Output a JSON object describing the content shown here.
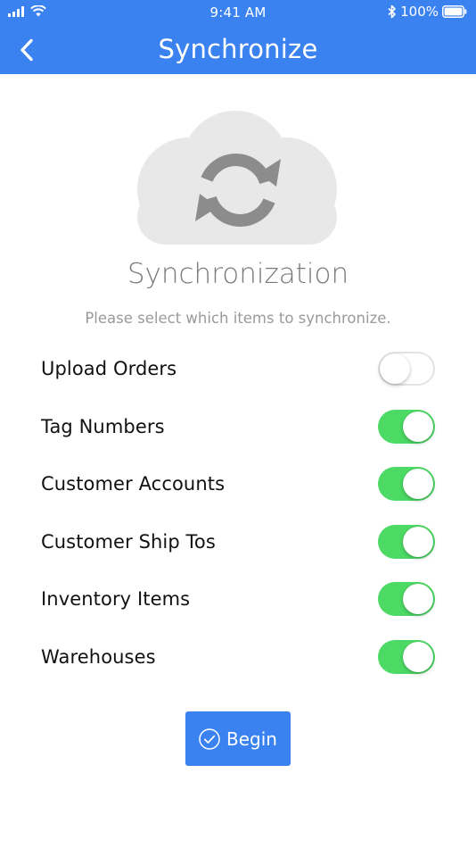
{
  "status_bar": {
    "time": "9:41 AM",
    "battery": "100%"
  },
  "nav": {
    "title": "Synchronize"
  },
  "hero": {
    "title": "Synchronization",
    "subtitle": "Please select which items to synchronize."
  },
  "options": [
    {
      "label": "Upload Orders",
      "enabled": false
    },
    {
      "label": "Tag Numbers",
      "enabled": true
    },
    {
      "label": "Customer Accounts",
      "enabled": true
    },
    {
      "label": "Customer Ship Tos",
      "enabled": true
    },
    {
      "label": "Inventory Items",
      "enabled": true
    },
    {
      "label": "Warehouses",
      "enabled": true
    }
  ],
  "begin_button": {
    "label": "Begin"
  },
  "colors": {
    "header": "#3b82f1",
    "toggle_on": "#4cd964",
    "cloud": "#e8e8e8",
    "sync_arrows": "#8c8c8c"
  },
  "icons": {
    "back": "chevron-left-icon",
    "hero": "cloud-sync-icon",
    "begin": "check-circle-icon"
  }
}
